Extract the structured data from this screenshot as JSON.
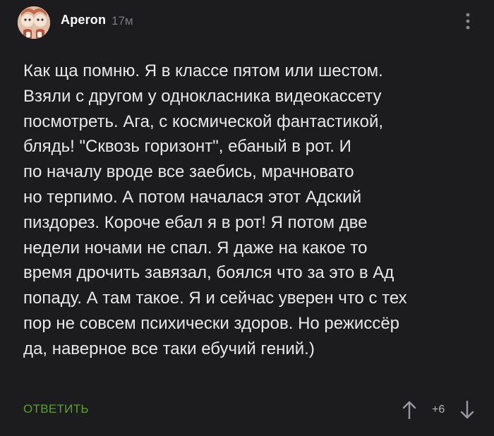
{
  "comment": {
    "author": "Aperon",
    "time": "17м",
    "avatar_icon": "avatar-illustration",
    "menu_icon": "more-vertical-icon",
    "text_lines": [
      "Как ща помню. Я в классе пятом или шестом.",
      "Взяли с другом у однокласника видеокассету",
      "посмотреть. Ага, с космической фантастикой,",
      "блядь! \"Сквозь горизонт\", ебаный в рот. И",
      "по началу вроде все заебись, мрачновато",
      "но терпимо. А потом началася этот Адский",
      "пиздорез. Короче ебал я в рот! Я потом две",
      "недели ночами не спал. Я даже на какое то",
      "время дрочить завязал, боялся что за это в Ад",
      "попаду. А там такое. Я и сейчас уверен что с тех",
      "пор не совсем психически здоров. Но режиссёр",
      "да, наверное все таки ебучий гений.)"
    ],
    "reply_label": "ОТВЕТИТЬ",
    "rating": "+6",
    "vote_up_icon": "arrow-up-icon",
    "vote_down_icon": "arrow-down-icon"
  },
  "colors": {
    "background": "#1c1c1e",
    "text": "#e8e8e8",
    "author": "#ffffff",
    "muted": "#7a7a7e",
    "reply": "#5aa02c"
  }
}
